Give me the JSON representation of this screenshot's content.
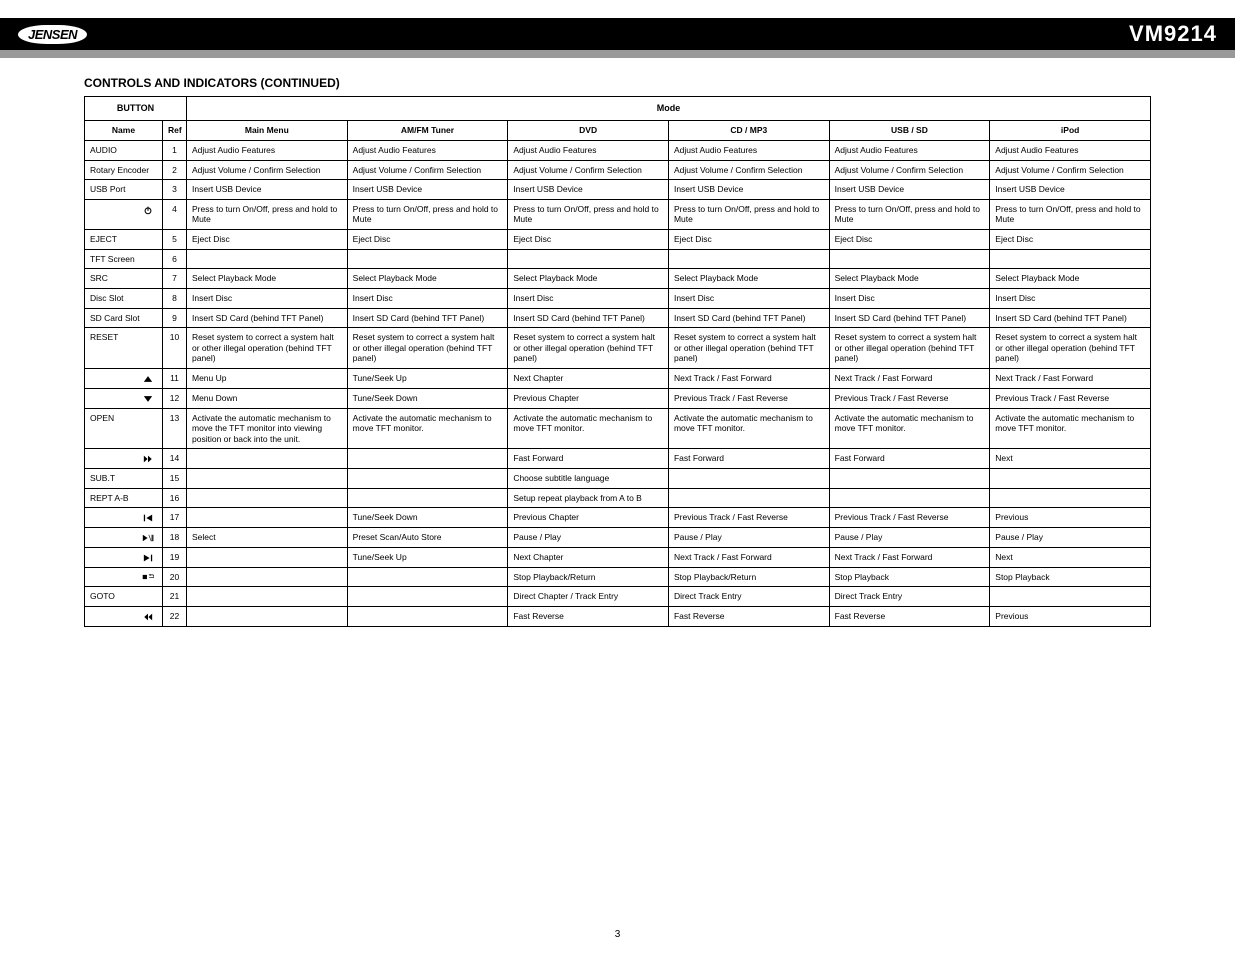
{
  "logo": "JENSEN",
  "model": "VM9214",
  "section_title": "CONTROLS AND INDICATORS (CONTINUED)",
  "page_number": "3",
  "table": {
    "group_headers": [
      "BUTTON",
      "Mode"
    ],
    "columns": [
      "Name",
      "Ref",
      "Main Menu",
      "AM/FM Tuner",
      "DVD",
      "CD / MP3",
      "USB / SD",
      "iPod"
    ],
    "rows": [
      {
        "name": "AUDIO",
        "ref": "1",
        "cells": [
          "Adjust Audio Features",
          "Adjust Audio Features",
          "Adjust Audio Features",
          "Adjust Audio Features",
          "Adjust Audio Features",
          "Adjust Audio Features"
        ]
      },
      {
        "name": "Rotary Encoder",
        "ref": "2",
        "cells": [
          "Adjust Volume / Confirm Selection",
          "Adjust Volume / Confirm Selection",
          "Adjust Volume / Confirm Selection",
          "Adjust Volume / Confirm Selection",
          "Adjust Volume / Confirm Selection",
          "Adjust Volume / Confirm Selection"
        ]
      },
      {
        "name": "USB Port",
        "ref": "3",
        "cells": [
          "Insert USB Device",
          "Insert USB Device",
          "Insert USB Device",
          "Insert USB Device",
          "Insert USB Device",
          "Insert USB Device"
        ]
      },
      {
        "name": "",
        "icon": "power",
        "ref": "4",
        "cells": [
          "Press to turn On/Off, press and hold to Mute",
          "Press to turn On/Off, press and hold to Mute",
          "Press to turn On/Off, press and hold to Mute",
          "Press to turn On/Off, press and hold to Mute",
          "Press to turn On/Off, press and hold to Mute",
          "Press to turn On/Off, press and hold to Mute"
        ]
      },
      {
        "name": "EJECT",
        "ref": "5",
        "cells": [
          "Eject Disc",
          "Eject Disc",
          "Eject Disc",
          "Eject Disc",
          "Eject Disc",
          "Eject Disc"
        ]
      },
      {
        "name": "TFT Screen",
        "ref": "6",
        "cells": [
          "",
          "",
          "",
          "",
          "",
          ""
        ]
      },
      {
        "name": "SRC",
        "ref": "7",
        "cells": [
          "Select Playback Mode",
          "Select Playback Mode",
          "Select Playback Mode",
          "Select Playback Mode",
          "Select Playback Mode",
          "Select Playback Mode"
        ]
      },
      {
        "name": "Disc Slot",
        "ref": "8",
        "cells": [
          "Insert Disc",
          "Insert Disc",
          "Insert Disc",
          "Insert Disc",
          "Insert Disc",
          "Insert Disc"
        ]
      },
      {
        "name": "SD Card Slot",
        "ref": "9",
        "cells": [
          "Insert SD Card (behind TFT Panel)",
          "Insert SD Card (behind TFT Panel)",
          "Insert SD Card (behind TFT Panel)",
          "Insert SD Card (behind TFT Panel)",
          "Insert SD Card (behind TFT Panel)",
          "Insert SD Card (behind TFT Panel)"
        ]
      },
      {
        "name": "RESET",
        "ref": "10",
        "cells": [
          "Reset system to correct a system halt or other illegal operation (behind TFT panel)",
          "Reset system to correct a system halt or other illegal operation (behind TFT panel)",
          "Reset system to correct a system halt or other illegal operation (behind TFT panel)",
          "Reset system to correct a system halt or other illegal operation (behind TFT panel)",
          "Reset system to correct a system halt or other illegal operation (behind TFT panel)",
          "Reset system to correct a system halt or other illegal operation (behind TFT panel)"
        ]
      },
      {
        "name": "",
        "icon": "up",
        "ref": "11",
        "cells": [
          "Menu Up",
          "Tune/Seek Up",
          "Next Chapter",
          "Next Track / Fast Forward",
          "Next Track / Fast Forward",
          "Next Track / Fast Forward"
        ]
      },
      {
        "name": "",
        "icon": "down",
        "ref": "12",
        "cells": [
          "Menu Down",
          "Tune/Seek Down",
          "Previous Chapter",
          "Previous Track / Fast Reverse",
          "Previous Track / Fast Reverse",
          "Previous Track / Fast Reverse"
        ]
      },
      {
        "name": "OPEN",
        "ref": "13",
        "cells": [
          "Activate the automatic mechanism to move the TFT monitor into viewing position or back into the unit.",
          "Activate the automatic mechanism to move TFT monitor.",
          "Activate the automatic mechanism to move TFT monitor.",
          "Activate the automatic mechanism to move TFT monitor.",
          "Activate the automatic mechanism to move TFT monitor.",
          "Activate the automatic mechanism to move TFT monitor."
        ]
      },
      {
        "name": "",
        "icon": "ff",
        "ref": "14",
        "cells": [
          "",
          "",
          "Fast Forward",
          "Fast Forward",
          "Fast Forward",
          "Next"
        ]
      },
      {
        "name": "SUB.T",
        "ref": "15",
        "cells": [
          "",
          "",
          "Choose subtitle language",
          "",
          "",
          ""
        ]
      },
      {
        "name": "REPT A-B",
        "ref": "16",
        "cells": [
          "",
          "",
          "Setup repeat playback from A to B",
          "",
          "",
          ""
        ]
      },
      {
        "name": "",
        "icon": "prevtrack",
        "ref": "17",
        "cells": [
          "",
          "Tune/Seek Down",
          "Previous Chapter",
          "Previous Track / Fast Reverse",
          "Previous Track / Fast Reverse",
          "Previous"
        ]
      },
      {
        "name": "",
        "icon": "playpause",
        "ref": "18",
        "cells": [
          "Select",
          "Preset Scan/Auto Store",
          "Pause / Play",
          "Pause / Play",
          "Pause / Play",
          "Pause / Play"
        ]
      },
      {
        "name": "",
        "icon": "nexttrack",
        "ref": "19",
        "cells": [
          "",
          "Tune/Seek Up",
          "Next Chapter",
          "Next Track / Fast Forward",
          "Next Track / Fast Forward",
          "Next"
        ]
      },
      {
        "name": "",
        "icon": "stopreturn",
        "ref": "20",
        "cells": [
          "",
          "",
          "Stop Playback/Return",
          "Stop Playback/Return",
          "Stop Playback",
          "Stop Playback"
        ]
      },
      {
        "name": "GOTO",
        "ref": "21",
        "cells": [
          "",
          "",
          "Direct Chapter / Track Entry",
          "Direct Track Entry",
          "Direct Track Entry",
          ""
        ]
      },
      {
        "name": "",
        "icon": "rw",
        "ref": "22",
        "cells": [
          "",
          "",
          "Fast Reverse",
          "Fast Reverse",
          "Fast Reverse",
          "Previous"
        ]
      }
    ]
  }
}
